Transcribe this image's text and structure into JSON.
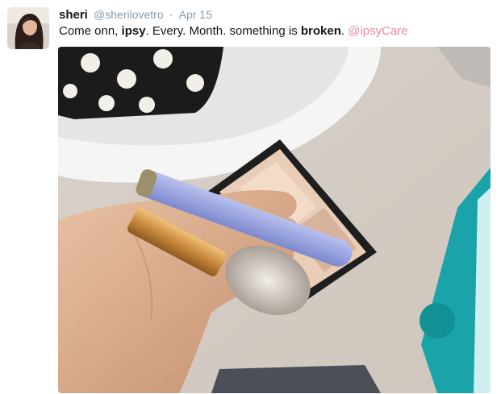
{
  "tweet": {
    "display_name": "sheri",
    "handle": "@sherilovetro",
    "separator": "·",
    "timestamp": "Apr 15",
    "text_part1": "Come onn, ",
    "text_bold1": "ipsy",
    "text_part2": ". Every.  Month. something is ",
    "text_bold2": "broken",
    "text_part3": ".  ",
    "mention": "@ipsyCare"
  },
  "colors": {
    "mention": "#e8899e",
    "meta_gray": "#8899a6",
    "text": "#14171a"
  },
  "icons": {
    "avatar": "profile-photo",
    "media": "photo-broken-makeup-brush"
  }
}
